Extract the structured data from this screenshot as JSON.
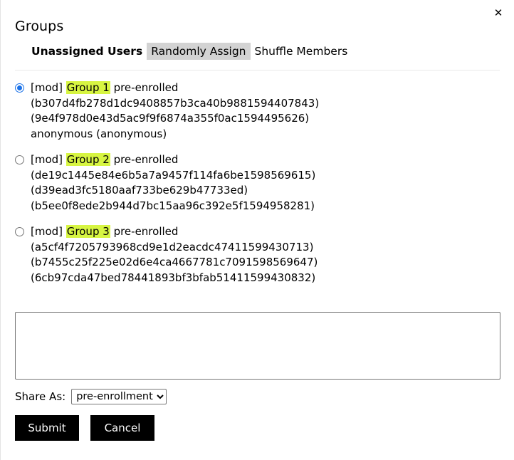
{
  "dialog": {
    "title": "Groups",
    "close_label": "✕"
  },
  "tabs": [
    {
      "label": "Unassigned Users",
      "state": "active"
    },
    {
      "label": "Randomly Assign",
      "state": "highlighted"
    },
    {
      "label": "Shuffle Members",
      "state": "normal"
    }
  ],
  "groups": [
    {
      "selected": true,
      "prefix": "[mod]",
      "name": "Group 1",
      "suffix": "pre-enrolled",
      "members": [
        "(b307d4fb278d1dc9408857b3ca40b9881594407843)",
        "(9e4f978d0e43d5ac9f9f6874a355f0ac1594495626)",
        "anonymous (anonymous)"
      ]
    },
    {
      "selected": false,
      "prefix": "[mod]",
      "name": "Group 2",
      "suffix": "pre-enrolled",
      "members": [
        "(de19c1445e84e6b5a7a9457f114fa6be1598569615)",
        "(d39ead3fc5180aaf733be629b47733ed)",
        "(b5ee0f8ede2b944d7bc15aa96c392e5f1594958281)"
      ]
    },
    {
      "selected": false,
      "prefix": "[mod]",
      "name": "Group 3",
      "suffix": "pre-enrolled",
      "members": [
        "(a5cf4f7205793968cd9e1d2eacdc47411599430713)",
        "(b7455c25f225e02d6e4ca4667781c7091598569647)",
        "(6cb97cda47bed78441893bf3bfab51411599430832)"
      ]
    }
  ],
  "note": {
    "value": "",
    "placeholder": ""
  },
  "share": {
    "label": "Share As:",
    "selected": "pre-enrollment",
    "options": [
      "pre-enrollment"
    ]
  },
  "actions": {
    "submit_label": "Submit",
    "cancel_label": "Cancel"
  },
  "colors": {
    "highlight": "#d7f542",
    "radio_accent": "#1b72e8",
    "button_bg": "#000000",
    "tab_highlight": "#d3d3d3"
  }
}
